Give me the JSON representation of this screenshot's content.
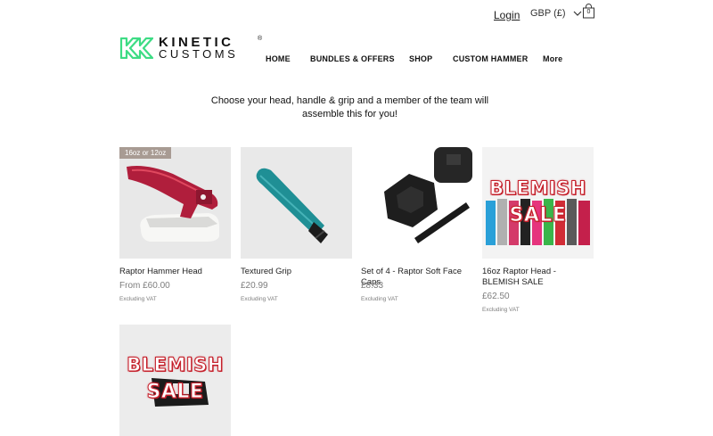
{
  "header": {
    "login_label": "Login",
    "currency_label": "GBP (£)",
    "cart_count": "0",
    "logo": {
      "line1": "KINETIC",
      "line2": "CUSTOMS",
      "reg": "®"
    },
    "nav": [
      {
        "label": "HOME"
      },
      {
        "label": "BUNDLES & OFFERS"
      },
      {
        "label": "SHOP"
      },
      {
        "label": "CUSTOM HAMMER"
      },
      {
        "label": "More"
      }
    ]
  },
  "intro": "Choose your head, handle & grip and a member of the team will assemble this for you!",
  "products": [
    {
      "ribbon": "16oz or 12oz",
      "name": "Raptor Hammer Head",
      "price": "From £60.00",
      "vat": "Excluding VAT"
    },
    {
      "name": "Textured Grip",
      "price": "£20.99",
      "vat": "Excluding VAT"
    },
    {
      "name": "Set of 4 - Raptor Soft Face Caps",
      "price": "£8.33",
      "vat": "Excluding VAT"
    },
    {
      "name": "16oz Raptor Head - BLEMISH SALE",
      "price": "£62.50",
      "vat": "Excluding VAT",
      "overlay_line1": "BLEMISH",
      "overlay_line2": "SALE"
    },
    {
      "overlay_line1": "BLEMISH",
      "overlay_line2": "SALE"
    }
  ],
  "colors": {
    "brand_green": "#3ddc84",
    "blemish_red": "#c5202b",
    "ribbon": "#a89b93",
    "price_grey": "#7d7d7d"
  },
  "icons": [
    "chevron-down-icon",
    "shopping-bag-icon",
    "kinetic-logo-mark"
  ]
}
